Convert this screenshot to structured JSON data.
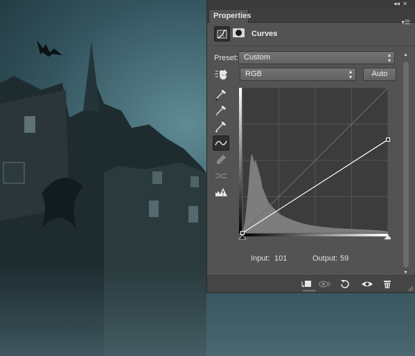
{
  "panel": {
    "tab_label": "Properties",
    "title": "Curves",
    "icons": {
      "adjustment": "curves-adjustment-icon",
      "mask": "layer-mask-icon",
      "menu": "panel-menu-icon"
    },
    "preset": {
      "label": "Preset:",
      "value": "Custom"
    },
    "channel": {
      "value": "RGB"
    },
    "auto_label": "Auto",
    "tools": [
      "on-image-adjust-icon",
      "sample-black-point-eyedropper-icon",
      "sample-gray-point-eyedropper-icon",
      "sample-white-point-eyedropper-icon",
      "edit-points-curve-icon",
      "draw-pencil-icon",
      "smooth-curve-icon",
      "clipping-warning-icon"
    ],
    "input_label": "Input:",
    "input_value": "101",
    "output_label": "Output:",
    "output_value": "59",
    "bottom_buttons": [
      "clip-to-layer-icon",
      "view-previous-state-icon",
      "reset-icon",
      "toggle-visibility-icon",
      "delete-adjustment-icon"
    ]
  },
  "curve": {
    "points_input": [
      0,
      255
    ],
    "points_output": [
      0,
      164
    ],
    "range": [
      0,
      255
    ]
  },
  "colors": {
    "panel_bg": "#535353",
    "graph_bg": "#3c3c3c",
    "histogram": "#7d7d7d",
    "curve": "#ffffff"
  }
}
